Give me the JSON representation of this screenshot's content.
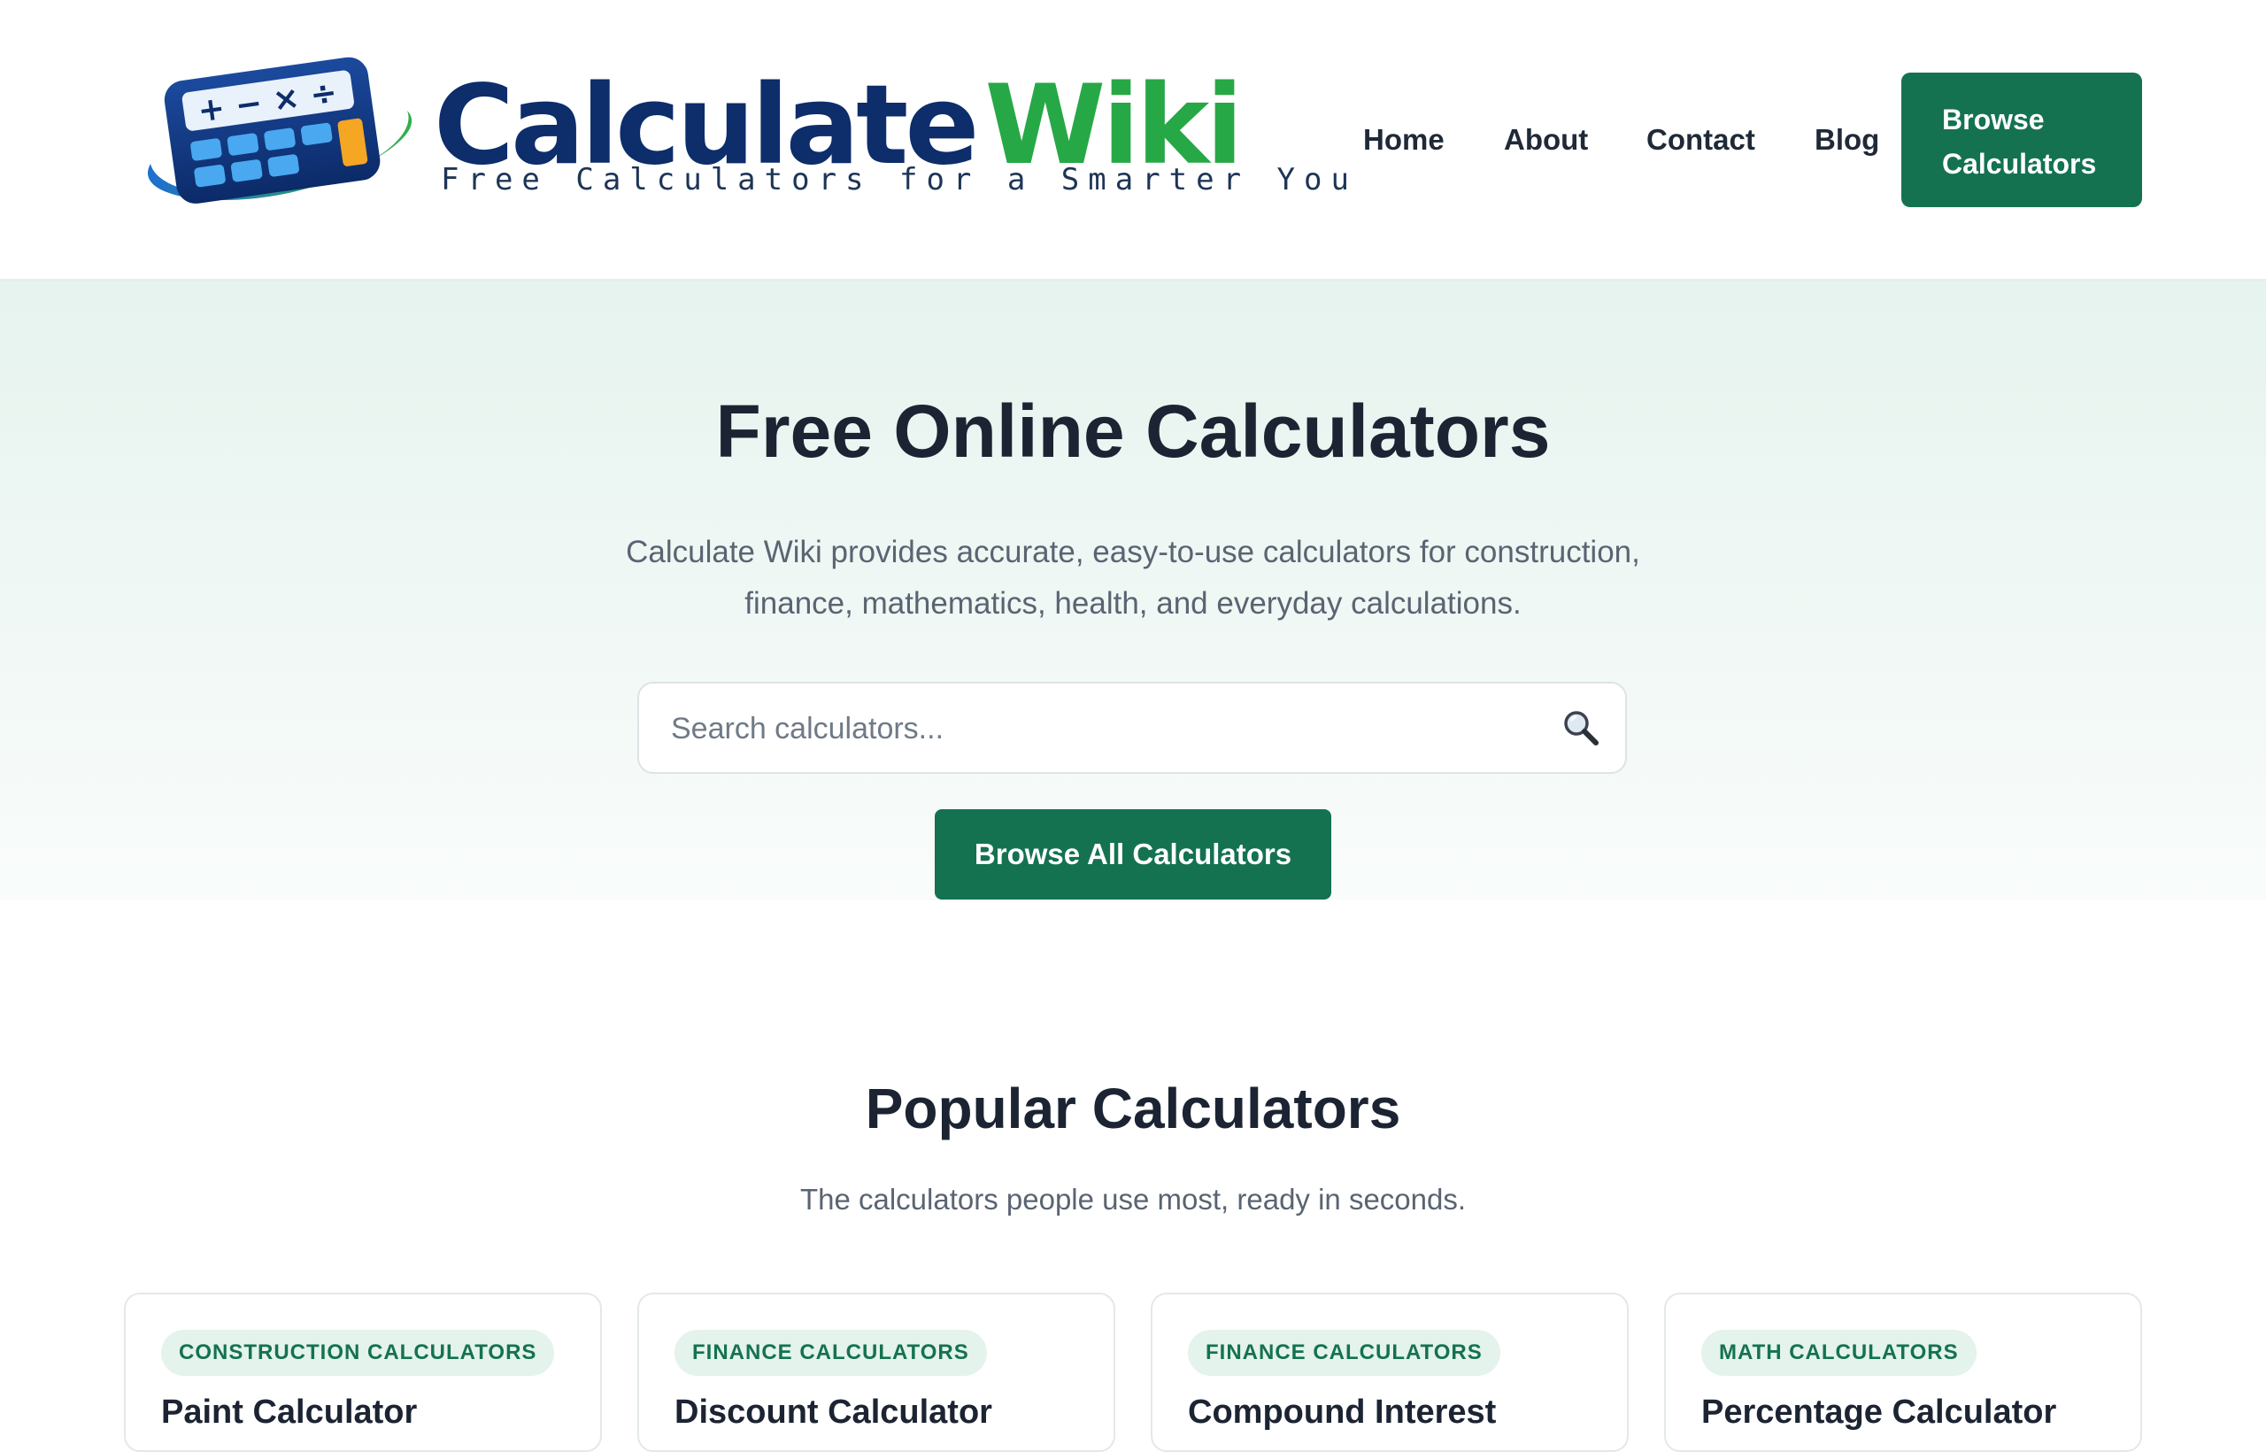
{
  "brand": {
    "word1": "Calculate",
    "word2": "Wiki",
    "tagline": "Free Calculators for a Smarter You",
    "colors": {
      "navy": "#0d2d6b",
      "green": "#27a846"
    }
  },
  "nav": {
    "items": [
      {
        "label": "Home"
      },
      {
        "label": "About"
      },
      {
        "label": "Contact"
      },
      {
        "label": "Blog"
      }
    ],
    "cta_line1": "Browse",
    "cta_line2": "Calculators"
  },
  "hero": {
    "title": "Free Online Calculators",
    "subtitle_line1": "Calculate Wiki provides accurate, easy-to-use calculators for construction,",
    "subtitle_line2": "finance, mathematics, health, and everyday calculations.",
    "search_placeholder": "Search calculators...",
    "button": "Browse All Calculators"
  },
  "popular": {
    "title": "Popular Calculators",
    "subtitle": "The calculators people use most, ready in seconds.",
    "cards": [
      {
        "category": "CONSTRUCTION CALCULATORS",
        "title": "Paint Calculator"
      },
      {
        "category": "FINANCE CALCULATORS",
        "title": "Discount Calculator"
      },
      {
        "category": "FINANCE CALCULATORS",
        "title": "Compound Interest"
      },
      {
        "category": "MATH CALCULATORS",
        "title": "Percentage Calculator"
      }
    ]
  },
  "theme": {
    "primary": "#147251",
    "badge_bg": "#e4f3ec"
  }
}
